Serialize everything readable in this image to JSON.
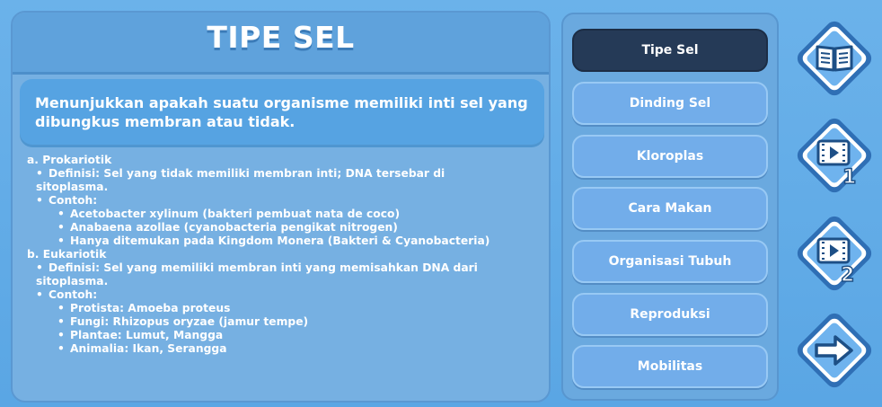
{
  "title": "TIPE SEL",
  "description": "Menunjukkan apakah suatu organisme memiliki inti sel yang dibungkus membran atau tidak.",
  "content": {
    "prokariotik": {
      "heading": "a. Prokariotik",
      "definisi_1": "Definisi: Sel yang tidak memiliki membran inti; DNA tersebar di",
      "definisi_2": "sitoplasma.",
      "contoh_label": "Contoh:",
      "examples": [
        "Acetobacter xylinum (bakteri pembuat nata de coco)",
        "Anabaena azollae (cyanobacteria pengikat nitrogen)",
        "Hanya ditemukan pada Kingdom Monera (Bakteri & Cyanobacteria)"
      ]
    },
    "eukariotik": {
      "heading": "b. Eukariotik",
      "definisi_1": "Definisi: Sel yang memiliki membran inti yang memisahkan DNA dari",
      "definisi_2": "sitoplasma.",
      "contoh_label": "Contoh:",
      "examples": [
        "Protista: Amoeba proteus",
        "Fungi: Rhizopus oryzae (jamur tempe)",
        "Plantae: Lumut, Mangga",
        "Animalia: Ikan, Serangga"
      ]
    }
  },
  "menu": [
    {
      "label": "Tipe Sel",
      "active": true
    },
    {
      "label": "Dinding Sel",
      "active": false
    },
    {
      "label": "Kloroplas",
      "active": false
    },
    {
      "label": "Cara Makan",
      "active": false
    },
    {
      "label": "Organisasi Tubuh",
      "active": false
    },
    {
      "label": "Reproduksi",
      "active": false
    },
    {
      "label": "Mobilitas",
      "active": false
    }
  ],
  "side_buttons": [
    {
      "icon": "book-icon"
    },
    {
      "icon": "video-1-icon",
      "number": "1"
    },
    {
      "icon": "video-2-icon",
      "number": "2"
    },
    {
      "icon": "arrow-right-icon"
    }
  ],
  "colors": {
    "background": "#5aa6e4",
    "active_menu": "#253a57",
    "menu_button": "#72adea",
    "side_button_outer": "#2f6fb5"
  }
}
